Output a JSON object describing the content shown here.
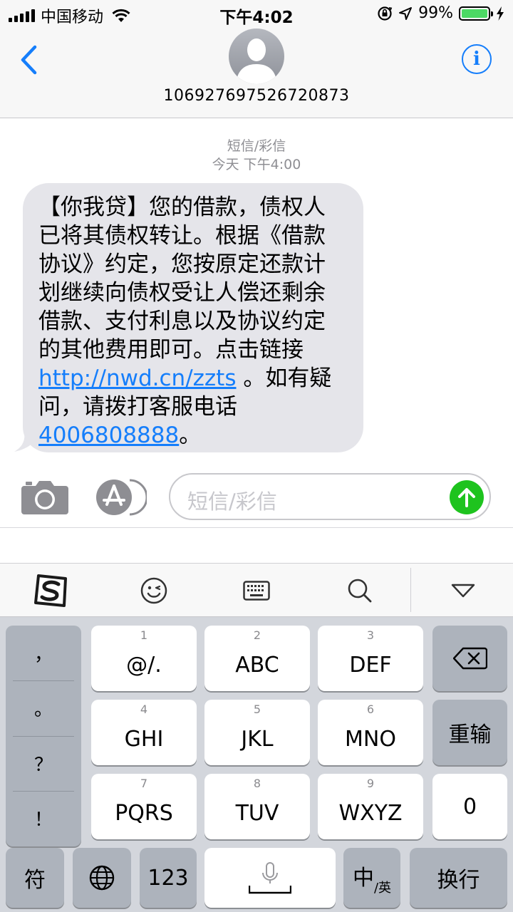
{
  "status_bar": {
    "carrier": "中国移动",
    "time": "下午4:02",
    "battery_percent": "99%",
    "battery_level": 0.99
  },
  "header": {
    "contact_number": "106927697526720873",
    "info_label": "i"
  },
  "thread": {
    "message_type": "短信/彩信",
    "timestamp": "今天 下午4:00",
    "message": {
      "lines": [
        "【你我贷】您的借款，债权人",
        "已将其债权转让。根据《借款",
        "协议》约定，您按原定还款计",
        "划继续向债权受让人偿还剩余",
        "借款、支付利息以及协议约定",
        "的其他费用即可。点击链接"
      ],
      "link": "http://nwd.cn/zzts",
      "after_link": " 。如有疑",
      "line8": "问，请拨打客服电话",
      "phone": "4006808888",
      "phone_suffix": "。"
    }
  },
  "compose": {
    "placeholder": "短信/彩信"
  },
  "keyboard": {
    "punctuation": [
      "，",
      "。",
      "？",
      "！"
    ],
    "keys": [
      {
        "num": "1",
        "label": "@/."
      },
      {
        "num": "2",
        "label": "ABC"
      },
      {
        "num": "3",
        "label": "DEF"
      },
      {
        "num": "4",
        "label": "GHI"
      },
      {
        "num": "5",
        "label": "JKL"
      },
      {
        "num": "6",
        "label": "MNO"
      },
      {
        "num": "7",
        "label": "PQRS"
      },
      {
        "num": "8",
        "label": "TUV"
      },
      {
        "num": "9",
        "label": "WXYZ"
      }
    ],
    "retype": "重输",
    "zero": "0",
    "symbols": "符",
    "num_mode": "123",
    "lang_main": "中",
    "lang_sub": "/英",
    "newline": "换行"
  },
  "colors": {
    "accent_blue": "#157efb",
    "send_green": "#1ec31e",
    "battery_green": "#4cd964",
    "bubble_gray": "#e5e5ea",
    "keyboard_bg": "#d3d6dc"
  },
  "icons": {
    "back": "chevron-left-icon",
    "info": "info-icon",
    "camera": "camera-icon",
    "app_store": "app-store-icon",
    "send": "arrow-up-icon",
    "sogou": "sogou-logo-icon",
    "emoji": "emoji-wink-icon",
    "keyboard": "keyboard-icon",
    "search": "search-icon",
    "dismiss": "triangle-down-icon",
    "backspace": "backspace-icon",
    "globe": "globe-icon",
    "mic": "microphone-icon"
  }
}
